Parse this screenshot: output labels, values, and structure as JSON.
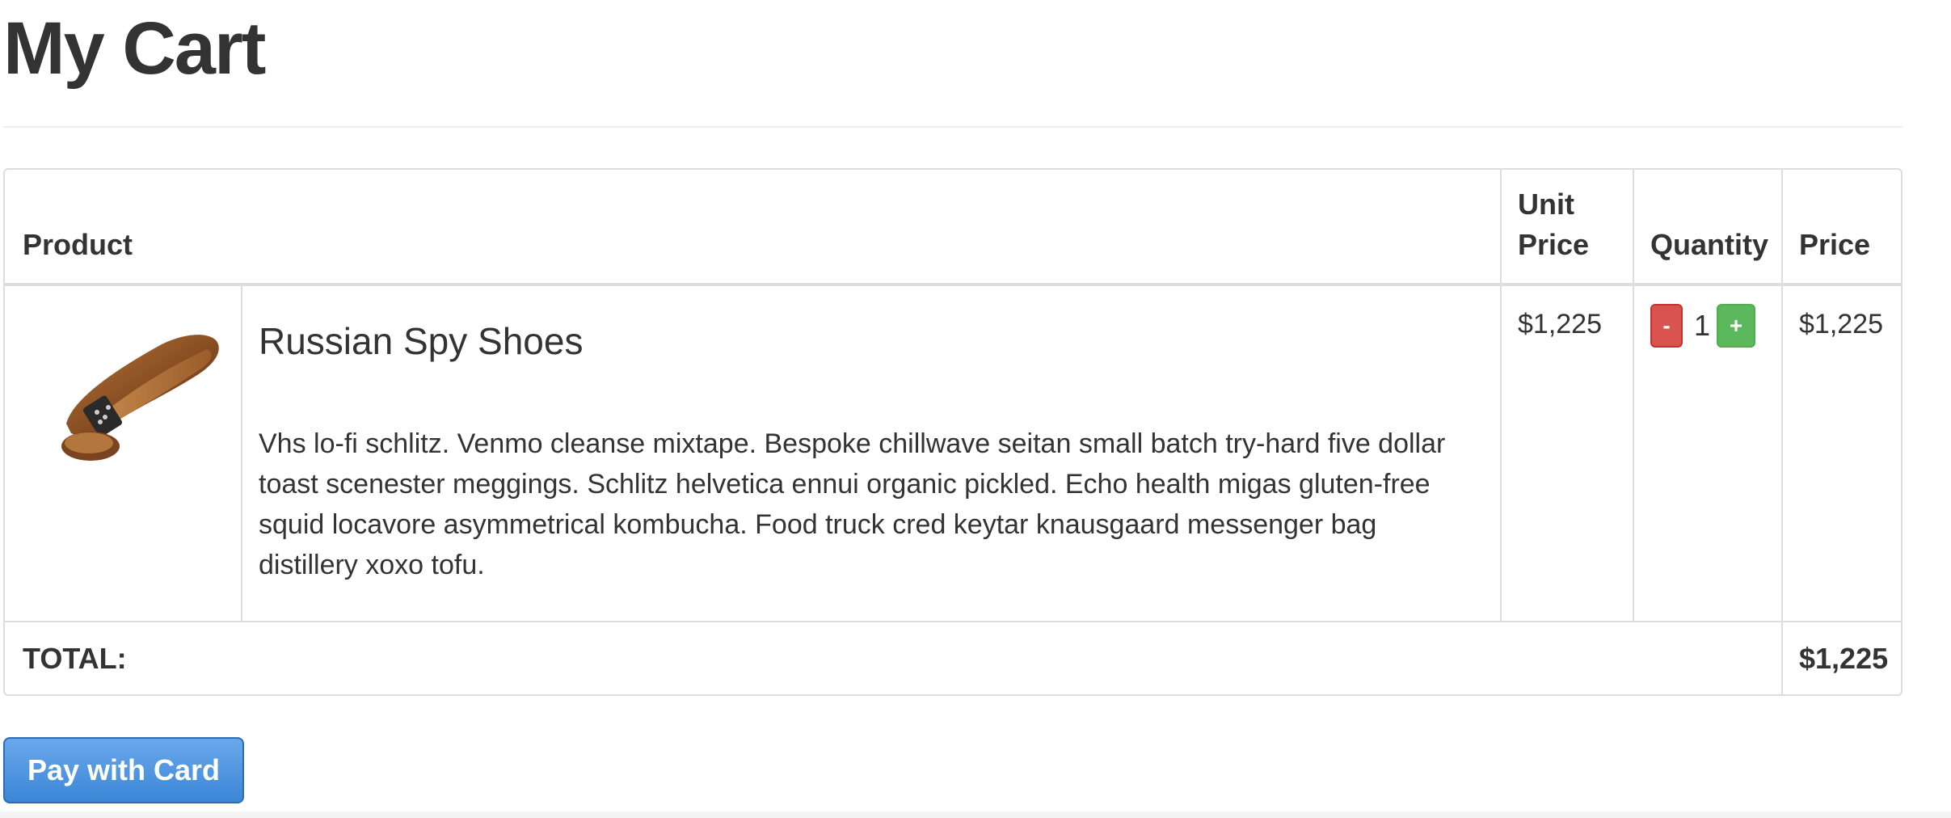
{
  "page": {
    "title": "My Cart"
  },
  "table": {
    "headers": {
      "product": "Product",
      "unit_price_line1": "Unit",
      "unit_price_line2": "Price",
      "quantity": "Quantity",
      "price": "Price"
    },
    "items": [
      {
        "name": "Russian Spy Shoes",
        "description": "Vhs lo-fi schlitz. Venmo cleanse mixtape. Bespoke chillwave seitan small batch try-hard five dollar toast scenester meggings. Schlitz helvetica ennui organic pickled. Echo health migas gluten-free squid locavore asymmetrical kombucha. Food truck cred keytar knausgaard messenger bag distillery xoxo tofu.",
        "unit_price": "$1,225",
        "quantity": "1",
        "price": "$1,225",
        "decrement_label": "-",
        "increment_label": "+"
      }
    ],
    "total_label": "TOTAL:",
    "total_value": "$1,225"
  },
  "actions": {
    "pay_label": "Pay with Card"
  },
  "colors": {
    "minus_button": "#d9534f",
    "plus_button": "#5cb85c",
    "pay_button": "#3b86d6"
  },
  "icons": {
    "product_image": "shoe-image"
  }
}
